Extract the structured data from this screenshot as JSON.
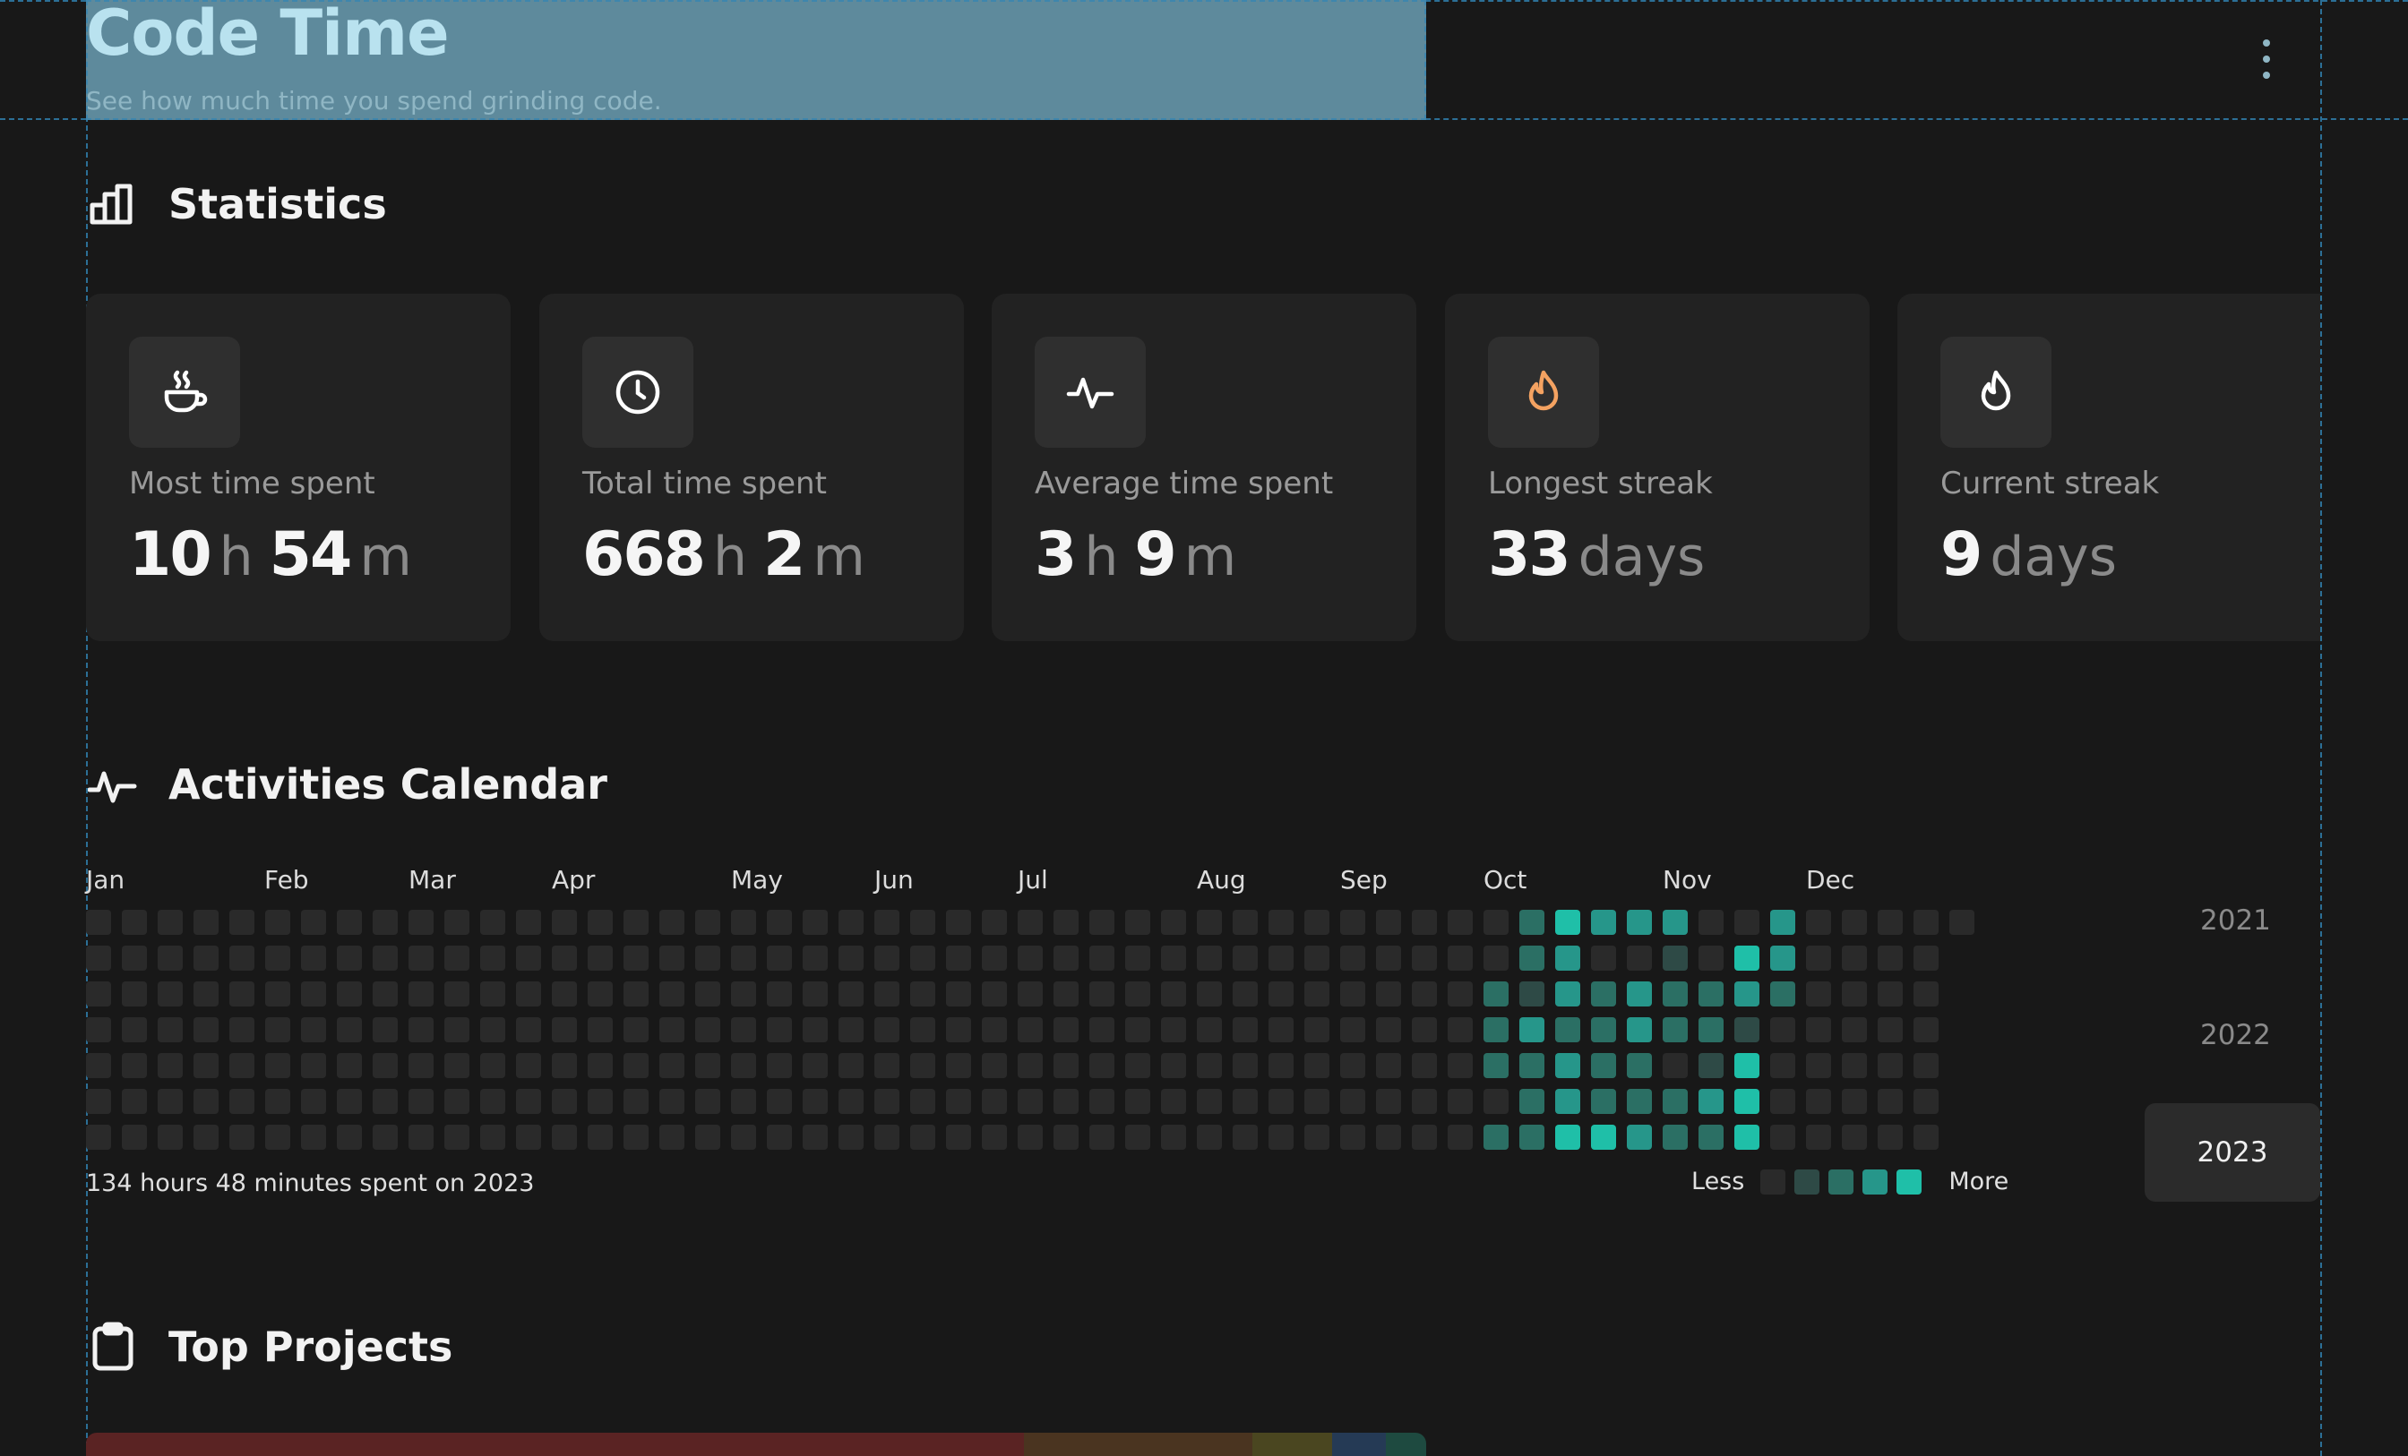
{
  "header": {
    "title": "Code Time",
    "subtitle": "See how much time you spend grinding code."
  },
  "statistics": {
    "title": "Statistics",
    "cards": [
      {
        "icon": "coffee-cup-icon",
        "label": "Most time spent",
        "parts": [
          {
            "num": "10",
            "unit": "h"
          },
          {
            "num": "54",
            "unit": "m"
          }
        ]
      },
      {
        "icon": "clock-icon",
        "label": "Total time spent",
        "parts": [
          {
            "num": "668",
            "unit": "h"
          },
          {
            "num": "2",
            "unit": "m"
          }
        ]
      },
      {
        "icon": "activity-icon",
        "label": "Average time spent",
        "parts": [
          {
            "num": "3",
            "unit": "h"
          },
          {
            "num": "9",
            "unit": "m"
          }
        ]
      },
      {
        "icon": "flame-orange-icon",
        "label": "Longest streak",
        "parts": [
          {
            "num": "33",
            "unit": "days"
          }
        ]
      },
      {
        "icon": "flame-icon",
        "label": "Current streak",
        "parts": [
          {
            "num": "9",
            "unit": "days"
          }
        ]
      }
    ]
  },
  "calendar": {
    "title": "Activities Calendar",
    "months": [
      "Jan",
      "Feb",
      "Mar",
      "Apr",
      "May",
      "Jun",
      "Jul",
      "Aug",
      "Sep",
      "Oct",
      "Nov",
      "Dec"
    ],
    "summary": "134 hours 48 minutes spent on 2023",
    "legend_less": "Less",
    "legend_more": "More",
    "years": [
      "2021",
      "2022",
      "2023"
    ],
    "active_year": "2023",
    "level_colors": [
      "#2a2a2a",
      "#2e4a46",
      "#2b6f64",
      "#26968a",
      "#1fbfa8"
    ],
    "activity": [
      {
        "week": 40,
        "day": 0,
        "level": 2
      },
      {
        "week": 41,
        "day": 0,
        "level": 4
      },
      {
        "week": 42,
        "day": 0,
        "level": 3
      },
      {
        "week": 43,
        "day": 0,
        "level": 3
      },
      {
        "week": 44,
        "day": 0,
        "level": 3
      },
      {
        "week": 47,
        "day": 0,
        "level": 3
      },
      {
        "week": 40,
        "day": 1,
        "level": 2
      },
      {
        "week": 41,
        "day": 1,
        "level": 3
      },
      {
        "week": 44,
        "day": 1,
        "level": 1
      },
      {
        "week": 46,
        "day": 1,
        "level": 4
      },
      {
        "week": 47,
        "day": 1,
        "level": 3
      },
      {
        "week": 39,
        "day": 2,
        "level": 2
      },
      {
        "week": 40,
        "day": 2,
        "level": 1
      },
      {
        "week": 41,
        "day": 2,
        "level": 3
      },
      {
        "week": 42,
        "day": 2,
        "level": 2
      },
      {
        "week": 43,
        "day": 2,
        "level": 3
      },
      {
        "week": 44,
        "day": 2,
        "level": 2
      },
      {
        "week": 45,
        "day": 2,
        "level": 2
      },
      {
        "week": 46,
        "day": 2,
        "level": 3
      },
      {
        "week": 47,
        "day": 2,
        "level": 2
      },
      {
        "week": 39,
        "day": 3,
        "level": 2
      },
      {
        "week": 40,
        "day": 3,
        "level": 3
      },
      {
        "week": 41,
        "day": 3,
        "level": 2
      },
      {
        "week": 42,
        "day": 3,
        "level": 2
      },
      {
        "week": 43,
        "day": 3,
        "level": 3
      },
      {
        "week": 44,
        "day": 3,
        "level": 2
      },
      {
        "week": 45,
        "day": 3,
        "level": 2
      },
      {
        "week": 46,
        "day": 3,
        "level": 1
      },
      {
        "week": 39,
        "day": 4,
        "level": 2
      },
      {
        "week": 40,
        "day": 4,
        "level": 2
      },
      {
        "week": 41,
        "day": 4,
        "level": 3
      },
      {
        "week": 42,
        "day": 4,
        "level": 2
      },
      {
        "week": 43,
        "day": 4,
        "level": 2
      },
      {
        "week": 45,
        "day": 4,
        "level": 1
      },
      {
        "week": 46,
        "day": 4,
        "level": 4
      },
      {
        "week": 40,
        "day": 5,
        "level": 2
      },
      {
        "week": 41,
        "day": 5,
        "level": 3
      },
      {
        "week": 42,
        "day": 5,
        "level": 2
      },
      {
        "week": 43,
        "day": 5,
        "level": 2
      },
      {
        "week": 44,
        "day": 5,
        "level": 2
      },
      {
        "week": 45,
        "day": 5,
        "level": 3
      },
      {
        "week": 46,
        "day": 5,
        "level": 4
      },
      {
        "week": 39,
        "day": 6,
        "level": 2
      },
      {
        "week": 40,
        "day": 6,
        "level": 2
      },
      {
        "week": 41,
        "day": 6,
        "level": 4
      },
      {
        "week": 42,
        "day": 6,
        "level": 4
      },
      {
        "week": 43,
        "day": 6,
        "level": 3
      },
      {
        "week": 44,
        "day": 6,
        "level": 2
      },
      {
        "week": 45,
        "day": 6,
        "level": 2
      },
      {
        "week": 46,
        "day": 6,
        "level": 4
      }
    ]
  },
  "projects": {
    "title": "Top Projects",
    "bar_colors": [
      "#5a2323",
      "#4a3420",
      "#4a4620",
      "#253a55",
      "#1e4a40"
    ],
    "bar_shares": [
      0.7,
      0.17,
      0.06,
      0.04,
      0.03
    ]
  }
}
